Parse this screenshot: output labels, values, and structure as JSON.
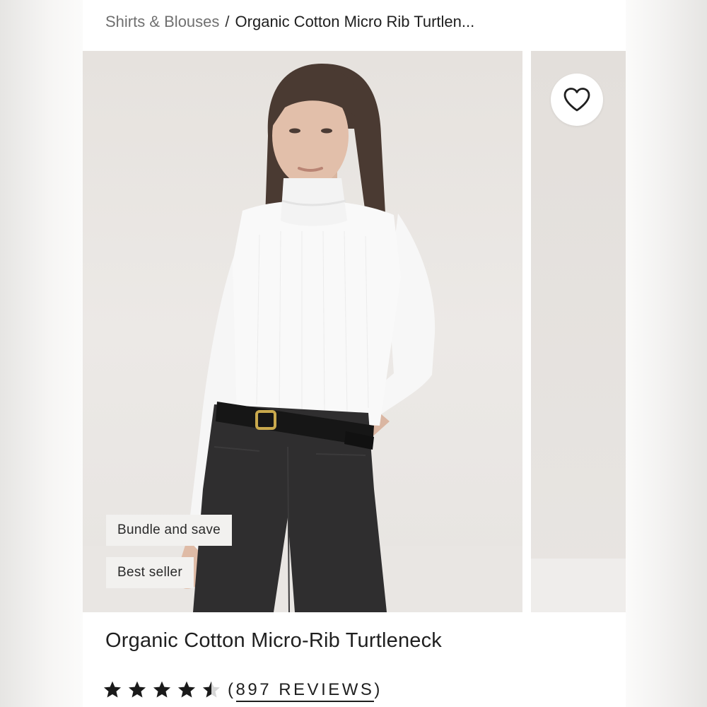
{
  "breadcrumb": {
    "parent": "Shirts & Blouses",
    "separator": "/",
    "current": "Organic Cotton Micro Rib Turtlen..."
  },
  "gallery": {
    "badges": [
      "Bundle and save",
      "Best seller"
    ],
    "favorite_icon": "heart-outline-icon"
  },
  "product": {
    "title": "Organic Cotton Micro-Rib Turtleneck",
    "rating": 4.5,
    "rating_max": 5,
    "reviews_open": "(",
    "reviews_count": "897",
    "reviews_word": "REVIEWS",
    "reviews_close": ")"
  },
  "colors": {
    "text": "#1f1f1f",
    "muted": "#707070",
    "background": "#ffffff",
    "badge": "#f2f1ef"
  }
}
